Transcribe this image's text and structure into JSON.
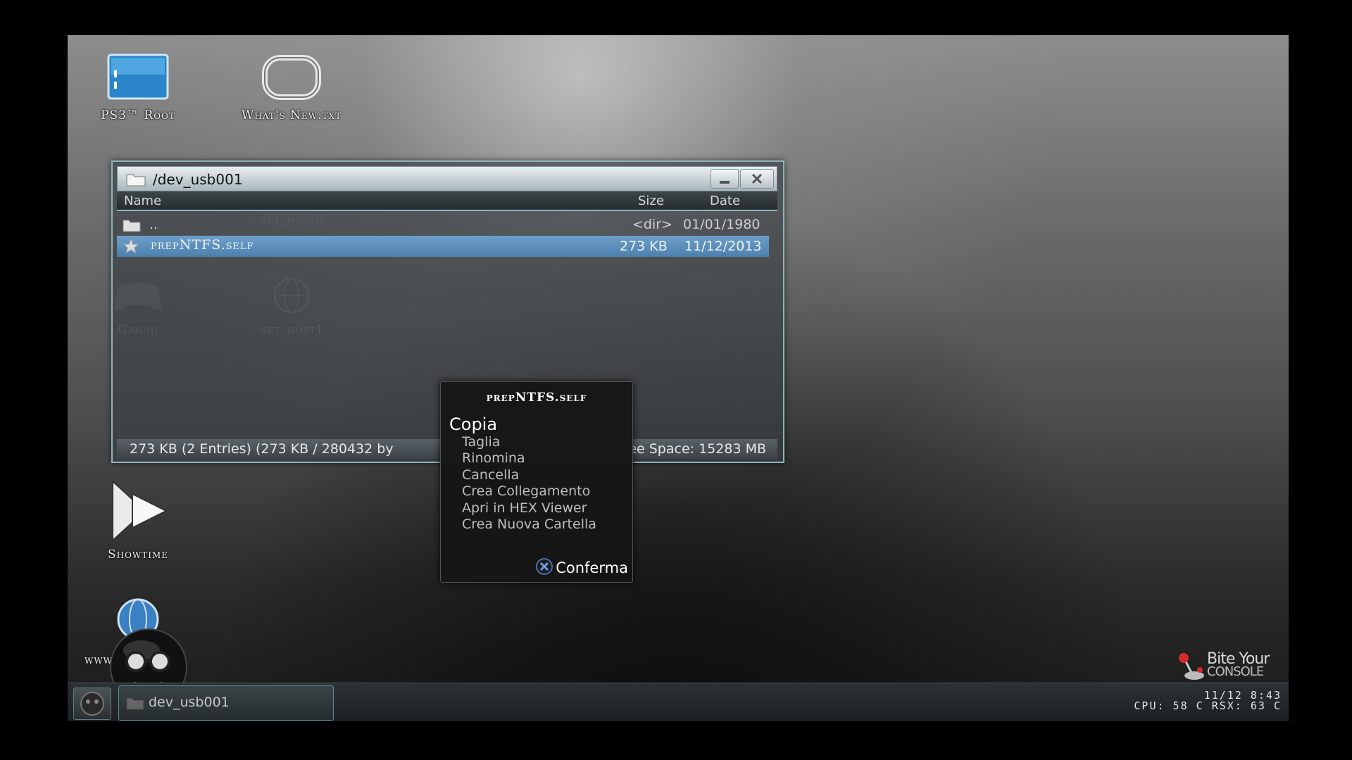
{
  "desktop": {
    "icons": [
      {
        "label": "PS3™ Root"
      },
      {
        "label": "What's New.txt"
      },
      {
        "label": "Giochi"
      },
      {
        "label": "net_host1"
      },
      {
        "label": "net_host0"
      },
      {
        "label": "Showtime"
      },
      {
        "label": "www"
      }
    ]
  },
  "window": {
    "title": "/dev_usb001",
    "columns": {
      "name": "Name",
      "size": "Size",
      "date": "Date"
    },
    "rows": [
      {
        "name": "..",
        "size": "<dir>",
        "date": "01/01/1980"
      },
      {
        "name": "prepNTFS.self",
        "size": "273 KB",
        "date": "11/12/2013"
      }
    ],
    "status_left": "273 KB (2 Entries) (273 KB / 280432 by",
    "status_right": "Free Space: 15283 MB"
  },
  "context_menu": {
    "title": "prepNTFS.self",
    "items": [
      "Copia",
      "Taglia",
      "Rinomina",
      "Cancella",
      "Crea Collegamento",
      "Apri in HEX Viewer",
      "Crea Nuova Cartella"
    ],
    "confirm_label": "Conferma"
  },
  "taskbar": {
    "task_label": "dev_usb001",
    "clock": "11/12  8:43",
    "temps": "CPU: 58 C RSX: 63 C"
  },
  "brand": {
    "line1": "Bite Your",
    "line2": "CONSOLE"
  },
  "colors": {
    "accent": "#8fb4bd",
    "selection": "#5b8dbb"
  }
}
